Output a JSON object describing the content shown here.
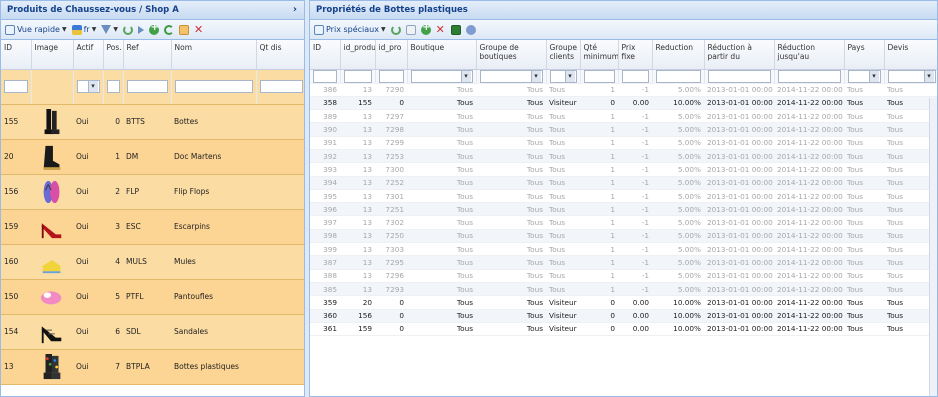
{
  "left": {
    "title": "Produits de Chaussez-vous / Shop A",
    "toolbar": {
      "view_label": "Vue rapide",
      "lang_label": "fr"
    },
    "columns": [
      "ID",
      "Image",
      "Actif",
      "Pos.",
      "Ref",
      "Nom",
      "Qt dis"
    ],
    "rows": [
      {
        "id": "155",
        "actif": "Oui",
        "pos": "0",
        "ref": "BTTS",
        "nom": "Bottes",
        "shoe": "boots"
      },
      {
        "id": "20",
        "actif": "Oui",
        "pos": "1",
        "ref": "DM",
        "nom": "Doc Martens",
        "shoe": "docs"
      },
      {
        "id": "156",
        "actif": "Oui",
        "pos": "2",
        "ref": "FLP",
        "nom": "Flip Flops",
        "shoe": "flipflop"
      },
      {
        "id": "159",
        "actif": "Oui",
        "pos": "3",
        "ref": "ESC",
        "nom": "Escarpins",
        "shoe": "heels"
      },
      {
        "id": "160",
        "actif": "Oui",
        "pos": "4",
        "ref": "MULS",
        "nom": "Mules",
        "shoe": "mules"
      },
      {
        "id": "150",
        "actif": "Oui",
        "pos": "5",
        "ref": "PTFL",
        "nom": "Pantoufles",
        "shoe": "slippers"
      },
      {
        "id": "154",
        "actif": "Oui",
        "pos": "6",
        "ref": "SDL",
        "nom": "Sandales",
        "shoe": "sandals"
      },
      {
        "id": "13",
        "actif": "Oui",
        "pos": "7",
        "ref": "BTPLA",
        "nom": "Bottes plastiques",
        "shoe": "rainboots"
      }
    ]
  },
  "right": {
    "title": "Propriétés de Bottes plastiques",
    "toolbar": {
      "specials_label": "Prix spéciaux"
    },
    "columns": [
      "ID",
      "id_produ",
      "id_pro",
      "Boutique",
      "Groupe de boutiques",
      "Groupe clients",
      "Qté minimum",
      "Prix fixe",
      "Reduction",
      "Réduction à partir du",
      "Réduction jusqu'au",
      "Pays",
      "Devis"
    ],
    "rows": [
      {
        "id": "386",
        "p": "13",
        "pa": "7290",
        "b": "Tous",
        "gb": "Tous",
        "gc": "Tous",
        "q": "1",
        "px": "-1",
        "r": "5.00%",
        "from": "2013-01-01 00:00",
        "to": "2014-11-22 00:00",
        "pays": "Tous",
        "dev": "Tous",
        "hl": false
      },
      {
        "id": "358",
        "p": "155",
        "pa": "0",
        "b": "Tous",
        "gb": "Tous",
        "gc": "Visiteur",
        "q": "0",
        "px": "0.00",
        "r": "10.00%",
        "from": "2013-01-01 00:00",
        "to": "2014-11-22 00:00",
        "pays": "Tous",
        "dev": "Tous",
        "hl": true
      },
      {
        "id": "389",
        "p": "13",
        "pa": "7297",
        "b": "Tous",
        "gb": "Tous",
        "gc": "Tous",
        "q": "1",
        "px": "-1",
        "r": "5.00%",
        "from": "2013-01-01 00:00",
        "to": "2014-11-22 00:00",
        "pays": "Tous",
        "dev": "Tous",
        "hl": false
      },
      {
        "id": "390",
        "p": "13",
        "pa": "7298",
        "b": "Tous",
        "gb": "Tous",
        "gc": "Tous",
        "q": "1",
        "px": "-1",
        "r": "5.00%",
        "from": "2013-01-01 00:00",
        "to": "2014-11-22 00:00",
        "pays": "Tous",
        "dev": "Tous",
        "hl": false
      },
      {
        "id": "391",
        "p": "13",
        "pa": "7299",
        "b": "Tous",
        "gb": "Tous",
        "gc": "Tous",
        "q": "1",
        "px": "-1",
        "r": "5.00%",
        "from": "2013-01-01 00:00",
        "to": "2014-11-22 00:00",
        "pays": "Tous",
        "dev": "Tous",
        "hl": false
      },
      {
        "id": "392",
        "p": "13",
        "pa": "7253",
        "b": "Tous",
        "gb": "Tous",
        "gc": "Tous",
        "q": "1",
        "px": "-1",
        "r": "5.00%",
        "from": "2013-01-01 00:00",
        "to": "2014-11-22 00:00",
        "pays": "Tous",
        "dev": "Tous",
        "hl": false
      },
      {
        "id": "393",
        "p": "13",
        "pa": "7300",
        "b": "Tous",
        "gb": "Tous",
        "gc": "Tous",
        "q": "1",
        "px": "-1",
        "r": "5.00%",
        "from": "2013-01-01 00:00",
        "to": "2014-11-22 00:00",
        "pays": "Tous",
        "dev": "Tous",
        "hl": false
      },
      {
        "id": "394",
        "p": "13",
        "pa": "7252",
        "b": "Tous",
        "gb": "Tous",
        "gc": "Tous",
        "q": "1",
        "px": "-1",
        "r": "5.00%",
        "from": "2013-01-01 00:00",
        "to": "2014-11-22 00:00",
        "pays": "Tous",
        "dev": "Tous",
        "hl": false
      },
      {
        "id": "395",
        "p": "13",
        "pa": "7301",
        "b": "Tous",
        "gb": "Tous",
        "gc": "Tous",
        "q": "1",
        "px": "-1",
        "r": "5.00%",
        "from": "2013-01-01 00:00",
        "to": "2014-11-22 00:00",
        "pays": "Tous",
        "dev": "Tous",
        "hl": false
      },
      {
        "id": "396",
        "p": "13",
        "pa": "7251",
        "b": "Tous",
        "gb": "Tous",
        "gc": "Tous",
        "q": "1",
        "px": "-1",
        "r": "5.00%",
        "from": "2013-01-01 00:00",
        "to": "2014-11-22 00:00",
        "pays": "Tous",
        "dev": "Tous",
        "hl": false
      },
      {
        "id": "397",
        "p": "13",
        "pa": "7302",
        "b": "Tous",
        "gb": "Tous",
        "gc": "Tous",
        "q": "1",
        "px": "-1",
        "r": "5.00%",
        "from": "2013-01-01 00:00",
        "to": "2014-11-22 00:00",
        "pays": "Tous",
        "dev": "Tous",
        "hl": false
      },
      {
        "id": "398",
        "p": "13",
        "pa": "7250",
        "b": "Tous",
        "gb": "Tous",
        "gc": "Tous",
        "q": "1",
        "px": "-1",
        "r": "5.00%",
        "from": "2013-01-01 00:00",
        "to": "2014-11-22 00:00",
        "pays": "Tous",
        "dev": "Tous",
        "hl": false
      },
      {
        "id": "399",
        "p": "13",
        "pa": "7303",
        "b": "Tous",
        "gb": "Tous",
        "gc": "Tous",
        "q": "1",
        "px": "-1",
        "r": "5.00%",
        "from": "2013-01-01 00:00",
        "to": "2014-11-22 00:00",
        "pays": "Tous",
        "dev": "Tous",
        "hl": false
      },
      {
        "id": "387",
        "p": "13",
        "pa": "7295",
        "b": "Tous",
        "gb": "Tous",
        "gc": "Tous",
        "q": "1",
        "px": "-1",
        "r": "5.00%",
        "from": "2013-01-01 00:00",
        "to": "2014-11-22 00:00",
        "pays": "Tous",
        "dev": "Tous",
        "hl": false
      },
      {
        "id": "388",
        "p": "13",
        "pa": "7296",
        "b": "Tous",
        "gb": "Tous",
        "gc": "Tous",
        "q": "1",
        "px": "-1",
        "r": "5.00%",
        "from": "2013-01-01 00:00",
        "to": "2014-11-22 00:00",
        "pays": "Tous",
        "dev": "Tous",
        "hl": false
      },
      {
        "id": "385",
        "p": "13",
        "pa": "7293",
        "b": "Tous",
        "gb": "Tous",
        "gc": "Tous",
        "q": "1",
        "px": "-1",
        "r": "5.00%",
        "from": "2013-01-01 00:00",
        "to": "2014-11-22 00:00",
        "pays": "Tous",
        "dev": "Tous",
        "hl": false
      },
      {
        "id": "359",
        "p": "20",
        "pa": "0",
        "b": "Tous",
        "gb": "Tous",
        "gc": "Visiteur",
        "q": "0",
        "px": "0.00",
        "r": "10.00%",
        "from": "2013-01-01 00:00",
        "to": "2014-11-22 00:00",
        "pays": "Tous",
        "dev": "Tous",
        "hl": true
      },
      {
        "id": "360",
        "p": "156",
        "pa": "0",
        "b": "Tous",
        "gb": "Tous",
        "gc": "Visiteur",
        "q": "0",
        "px": "0.00",
        "r": "10.00%",
        "from": "2013-01-01 00:00",
        "to": "2014-11-22 00:00",
        "pays": "Tous",
        "dev": "Tous",
        "hl": true
      },
      {
        "id": "361",
        "p": "159",
        "pa": "0",
        "b": "Tous",
        "gb": "Tous",
        "gc": "Visiteur",
        "q": "0",
        "px": "0.00",
        "r": "10.00%",
        "from": "2013-01-01 00:00",
        "to": "2014-11-22 00:00",
        "pays": "Tous",
        "dev": "Tous",
        "hl": true
      }
    ]
  }
}
